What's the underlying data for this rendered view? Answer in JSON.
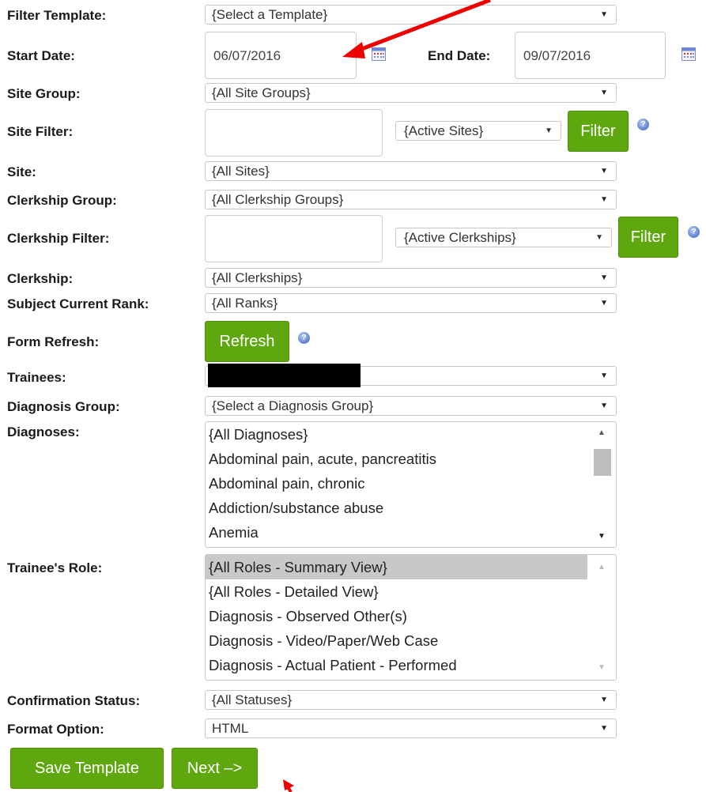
{
  "labels": {
    "filter_template": "Filter Template:",
    "start_date": "Start Date:",
    "end_date": "End Date:",
    "site_group": "Site Group:",
    "site_filter": "Site Filter:",
    "site": "Site:",
    "clerkship_group": "Clerkship Group:",
    "clerkship_filter": "Clerkship Filter:",
    "clerkship": "Clerkship:",
    "subject_rank": "Subject Current Rank:",
    "form_refresh": "Form Refresh:",
    "trainees": "Trainees:",
    "diagnosis_group": "Diagnosis Group:",
    "diagnoses": "Diagnoses:",
    "trainee_role": "Trainee's Role:",
    "confirmation_status": "Confirmation Status:",
    "format_option": "Format Option:"
  },
  "fields": {
    "filter_template": "{Select a Template}",
    "start_date": "06/07/2016",
    "end_date": "09/07/2016",
    "site_group": "{All Site Groups}",
    "site_filter_text": "",
    "site_filter_select": "{Active Sites}",
    "site": "{All Sites}",
    "clerkship_group": "{All Clerkship Groups}",
    "clerkship_filter_text": "",
    "clerkship_filter_select": "{Active Clerkships}",
    "clerkship": "{All Clerkships}",
    "subject_rank": "{All Ranks}",
    "trainees": "",
    "diagnosis_group": "{Select a Diagnosis Group}",
    "confirmation_status": "{All Statuses}",
    "format_option": "HTML"
  },
  "diagnoses_options": [
    "{All Diagnoses}",
    "Abdominal pain, acute, pancreatitis",
    "Abdominal pain, chronic",
    "Addiction/substance abuse",
    "Anemia"
  ],
  "role_options": [
    "{All Roles - Summary View}",
    "{All Roles - Detailed View}",
    "Diagnosis - Observed Other(s)",
    "Diagnosis - Video/Paper/Web Case",
    "Diagnosis - Actual Patient - Performed"
  ],
  "role_selected_index": 0,
  "buttons": {
    "filter": "Filter",
    "refresh": "Refresh",
    "save_template": "Save Template",
    "next": "Next –>"
  },
  "icons": {
    "help": "help-icon",
    "calendar": "calendar-icon",
    "dropdown": "chevron-down-icon",
    "annotation_arrow": "red-arrow-icon"
  },
  "colors": {
    "button_green": "#5ea70f",
    "annotation_red": "#ee0000",
    "redaction": "#000000"
  }
}
